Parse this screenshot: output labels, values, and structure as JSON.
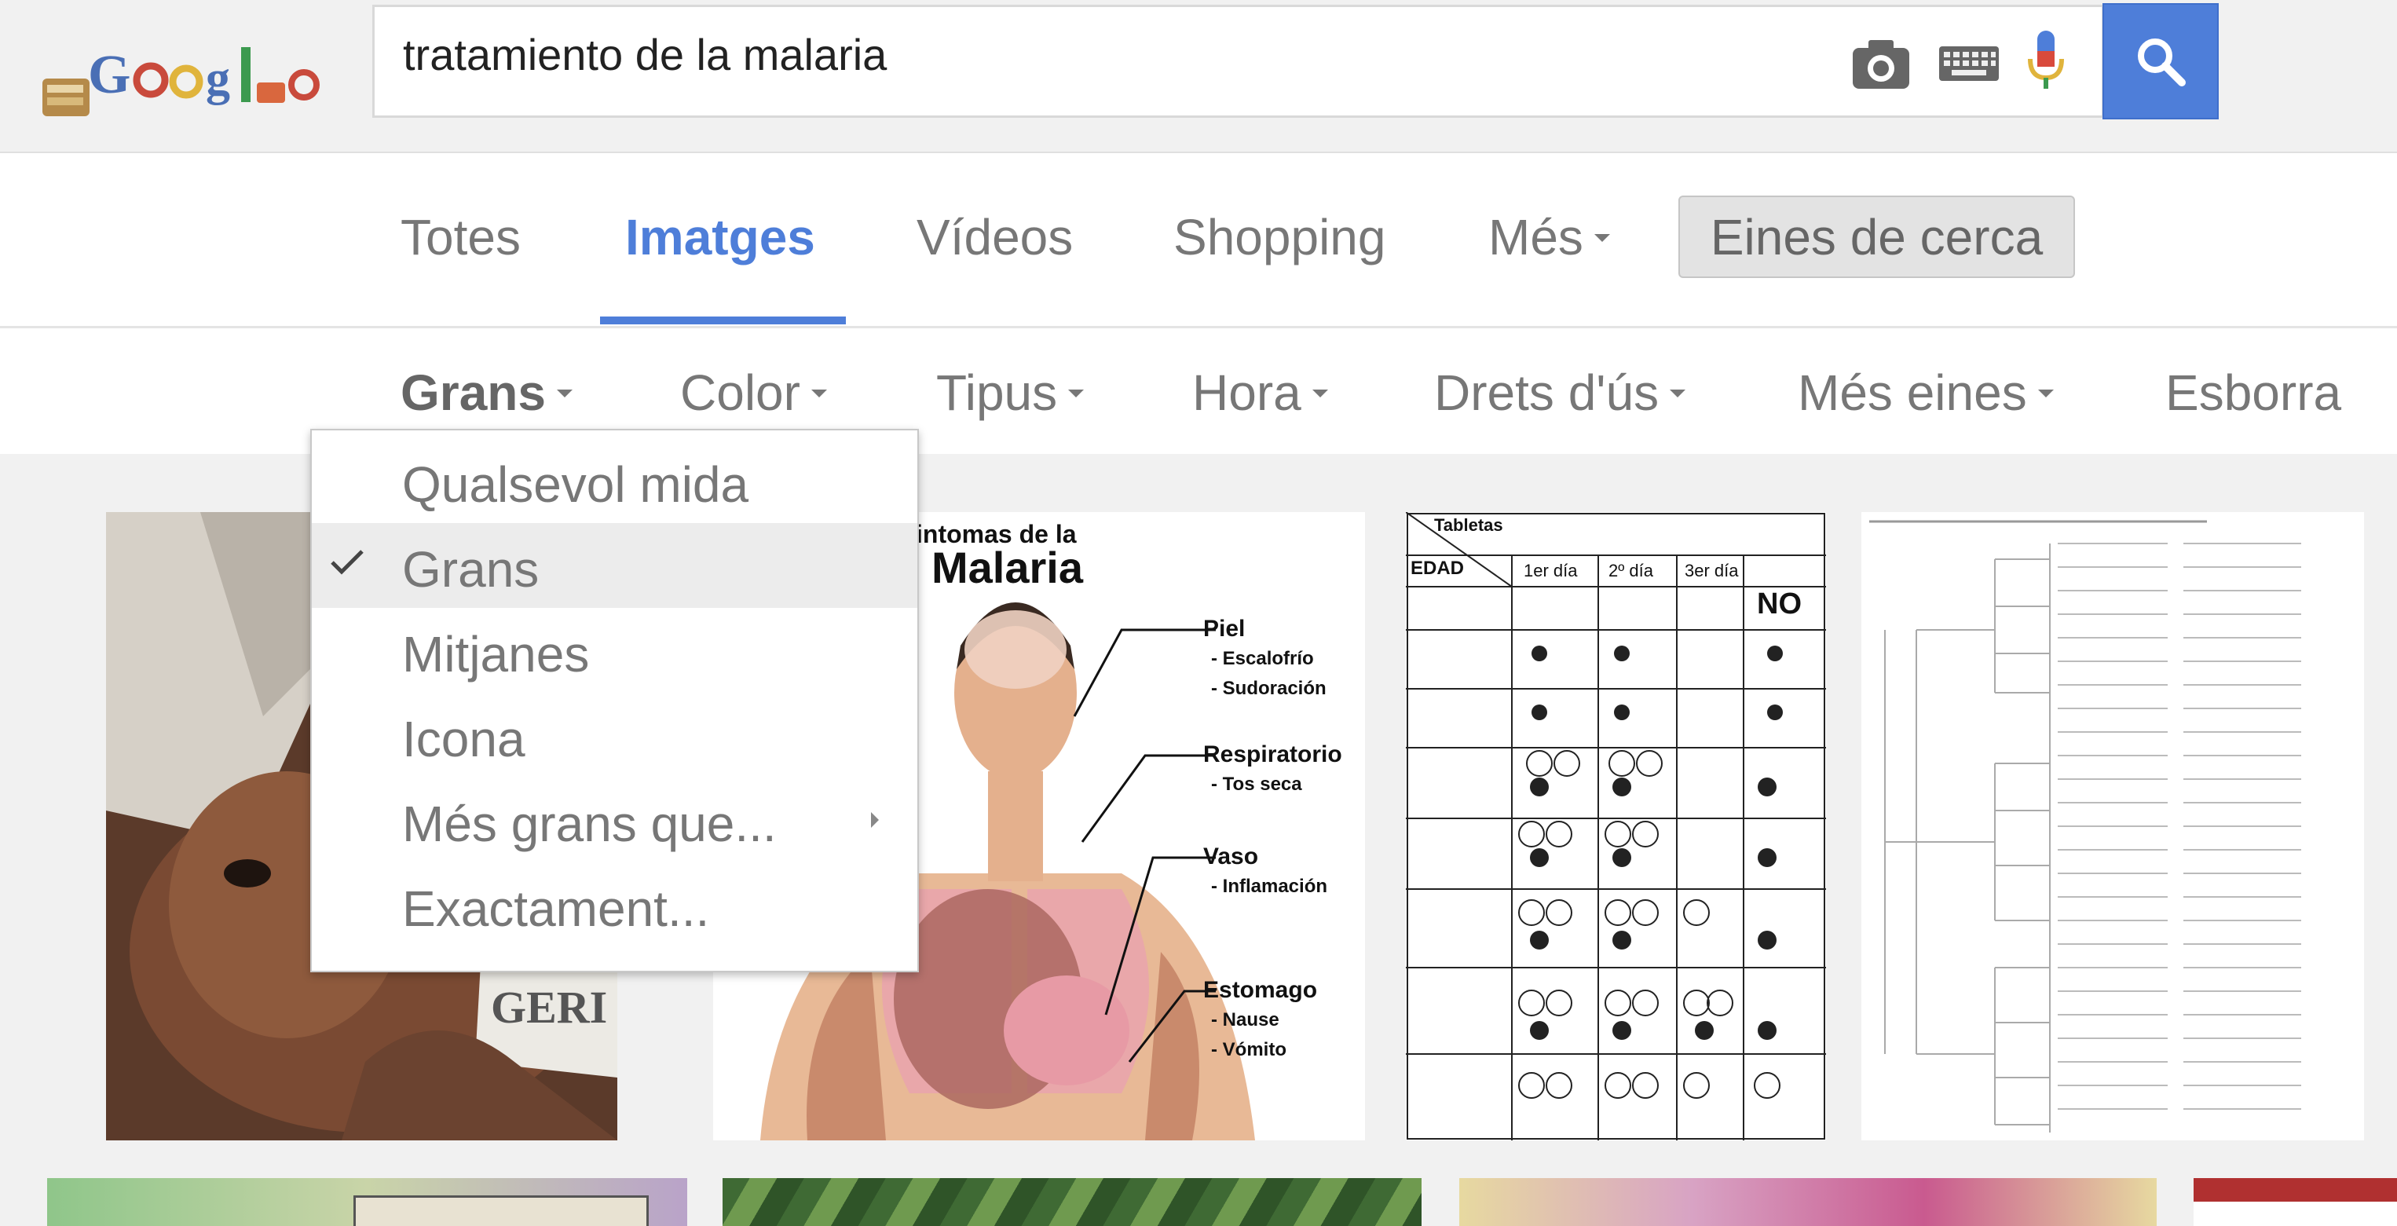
{
  "search": {
    "query": "tratamiento de la malaria"
  },
  "nav": {
    "tabs": [
      "Totes",
      "Imatges",
      "Vídeos",
      "Shopping",
      "Més"
    ],
    "tools": "Eines de cerca"
  },
  "filters": [
    "Grans",
    "Color",
    "Tipus",
    "Hora",
    "Drets d'ús",
    "Més eines",
    "Esborra"
  ],
  "size_menu": {
    "items": [
      "Qualsevol mida",
      "Grans",
      "Mitjanes",
      "Icona",
      "Més grans que...",
      "Exactament..."
    ],
    "selected": "Grans"
  },
  "results": {
    "poster": {
      "title_line1": "intomas de la",
      "title_line2": "Malaria",
      "labels": [
        "Piel",
        "- Escalofrío",
        "- Sudoración",
        "Respiratorio",
        "- Tos seca",
        "Vaso",
        "- Inflamación",
        "Estomago",
        "- Nause",
        "- Vómito"
      ]
    },
    "dosage_table": {
      "header_tablets": "Tabletas",
      "header_age": "EDAD",
      "days": [
        "1er día",
        "2º día",
        "3er día"
      ],
      "no_label": "NO"
    },
    "photo_text": "GERI"
  },
  "colors": {
    "accent": "#4e7ed9",
    "background": "#f1f1f1"
  }
}
